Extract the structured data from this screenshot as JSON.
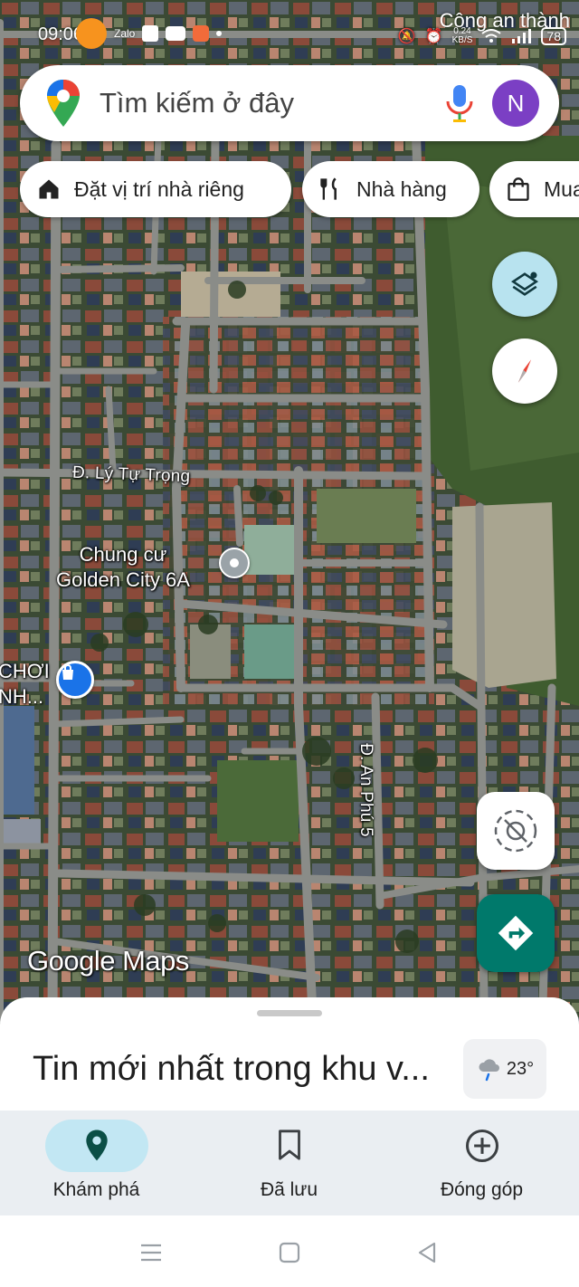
{
  "status_bar": {
    "time": "09:06",
    "notification": "Công an thành",
    "network_speed": "0.24\nKB/S",
    "battery": "78"
  },
  "search": {
    "placeholder": "Tìm kiếm ở đây",
    "avatar_initial": "N"
  },
  "chips": [
    {
      "label": "Đặt vị trí nhà riêng",
      "icon": "home-icon"
    },
    {
      "label": "Nhà hàng",
      "icon": "restaurant-icon"
    },
    {
      "label": "Mua",
      "icon": "shopping-bag-icon"
    }
  ],
  "map": {
    "street_ly_tu_trong": "Đ. Lý Tự Trọng",
    "street_an_phu_5": "Đ. An Phú 5",
    "place_golden_city": "Chung cư\nGolden City 6A",
    "place_partial": "CHƠI\nNH...",
    "watermark": "Google Maps"
  },
  "sheet": {
    "title": "Tin mới nhất trong khu v...",
    "weather_temp": "23°"
  },
  "bottom_nav": [
    {
      "label": "Khám phá",
      "icon": "location-pin-icon",
      "active": true
    },
    {
      "label": "Đã lưu",
      "icon": "bookmark-icon",
      "active": false
    },
    {
      "label": "Đóng góp",
      "icon": "add-circle-icon",
      "active": false
    }
  ],
  "colors": {
    "accent_teal": "#00796b",
    "active_pill": "#c2e7f3",
    "layers_fab": "#b8e3ef",
    "avatar": "#7b3fc4"
  }
}
